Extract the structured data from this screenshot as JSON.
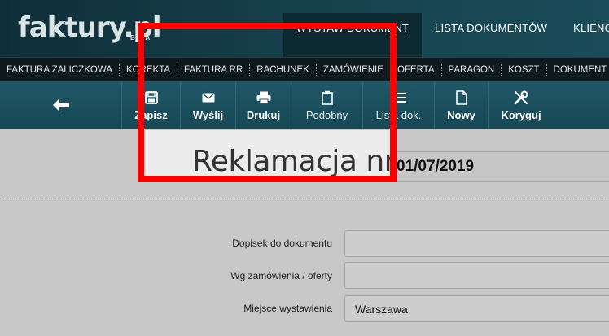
{
  "header": {
    "logo_text": "faktury.pl",
    "logo_badge": "BETA",
    "nav": [
      {
        "label": "WYSTAW DOKUMENT",
        "active": true
      },
      {
        "label": "LISTA DOKUMENTÓW",
        "active": false
      },
      {
        "label": "KLIENCI",
        "active": false
      }
    ]
  },
  "doc_types": [
    "FAKTURA ZALICZKOWA",
    "KOREKTA",
    "FAKTURA RR",
    "RACHUNEK",
    "ZAMÓWIENIE",
    "OFERTA",
    "PARAGON",
    "KOSZT",
    "DOKUMENT"
  ],
  "toolbar": {
    "buttons": [
      {
        "label": "Zapisz",
        "icon": "save-icon"
      },
      {
        "label": "Wyślij",
        "icon": "envelope-icon"
      },
      {
        "label": "Drukuj",
        "icon": "printer-icon"
      },
      {
        "label": "Podobny",
        "icon": "copy-icon"
      },
      {
        "label": "Lista dok.",
        "icon": "list-icon"
      },
      {
        "label": "Nowy",
        "icon": "new-document-icon"
      },
      {
        "label": "Koryguj",
        "icon": "tools-icon"
      }
    ]
  },
  "document": {
    "title": "Reklamacja nr",
    "number": "01/07/2019"
  },
  "form": {
    "rows": [
      {
        "label": "Dopisek do dokumentu",
        "value": ""
      },
      {
        "label": "Wg zamówienia / oferty",
        "value": ""
      },
      {
        "label": "Miejsce wystawienia",
        "value": "Warszawa"
      }
    ]
  },
  "colors": {
    "header": "#16414d",
    "toolbar": "#205867",
    "annotation": "#ff0000"
  }
}
